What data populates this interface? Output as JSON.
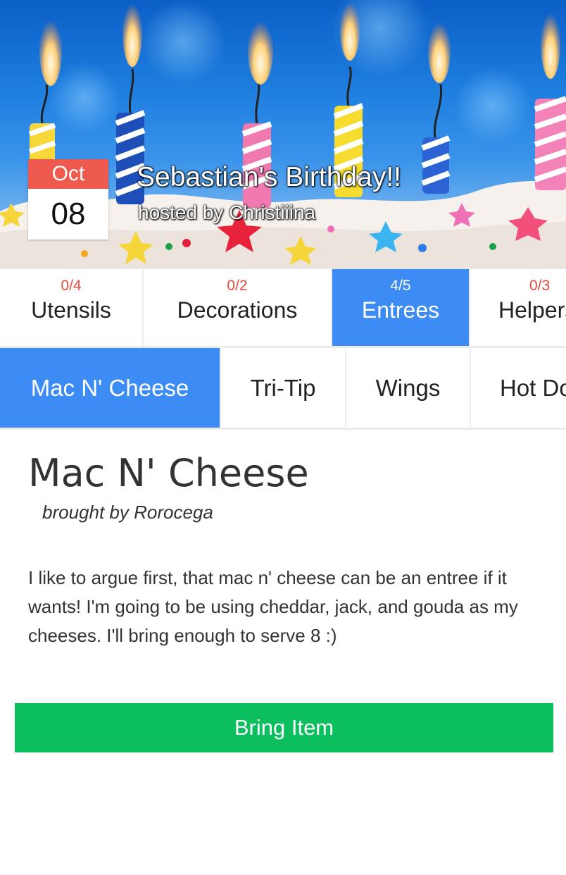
{
  "event": {
    "month": "Oct",
    "day": "08",
    "title": "Sebastian's Birthday!!",
    "host_line": "hosted by Christiiina"
  },
  "category_tabs": [
    {
      "count": "0/4",
      "label": "Utensils",
      "active": false
    },
    {
      "count": "0/2",
      "label": "Decorations",
      "active": false
    },
    {
      "count": "4/5",
      "label": "Entrees",
      "active": true
    },
    {
      "count": "0/3",
      "label": "Helpers",
      "active": false
    }
  ],
  "item_tabs": [
    {
      "label": "Mac N' Cheese",
      "active": true
    },
    {
      "label": "Tri-Tip",
      "active": false
    },
    {
      "label": "Wings",
      "active": false
    },
    {
      "label": "Hot Dogs",
      "active": false
    }
  ],
  "selected_item": {
    "title": "Mac N' Cheese",
    "brought_by": "brought by Rorocega",
    "description": "I like to argue first, that mac n' cheese can be an entree if it wants! I'm going to be using cheddar, jack, and gouda as my cheeses. I'll bring enough to serve 8 :)"
  },
  "actions": {
    "bring_label": "Bring Item"
  },
  "colors": {
    "accent": "#3d8bf5",
    "count_red": "#e8483f",
    "badge_red": "#ef5a4f",
    "bring_green": "#0cbf5e"
  }
}
